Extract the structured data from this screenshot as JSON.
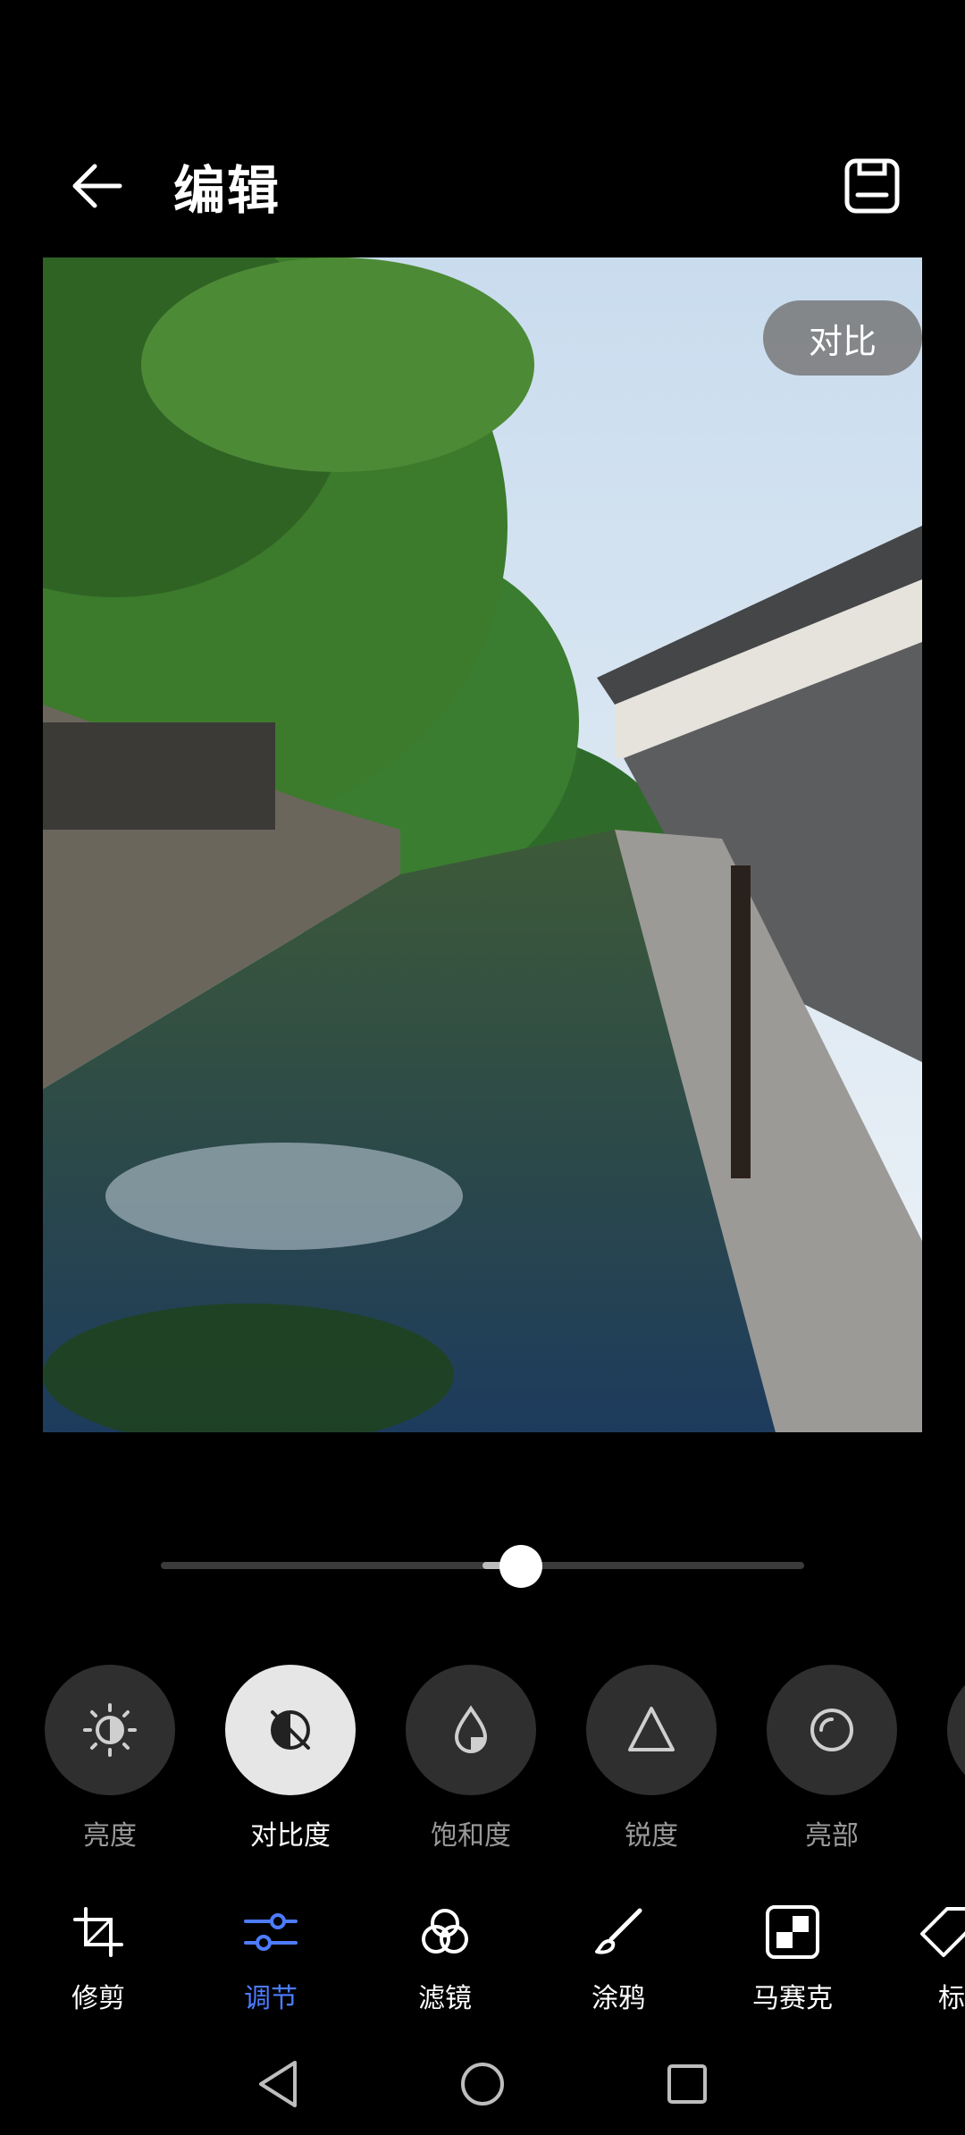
{
  "header": {
    "title": "编辑",
    "back_icon": "arrow-left-icon",
    "save_icon": "save-icon"
  },
  "photo": {
    "tag": "对比",
    "description_icon": "photo-canal-scene"
  },
  "slider": {
    "value_percent": 56
  },
  "adjust_tools": [
    {
      "label": "亮度",
      "icon": "brightness-icon",
      "active": false
    },
    {
      "label": "对比度",
      "icon": "contrast-icon",
      "active": true
    },
    {
      "label": "饱和度",
      "icon": "saturation-icon",
      "active": false
    },
    {
      "label": "锐度",
      "icon": "sharpness-icon",
      "active": false
    },
    {
      "label": "亮部",
      "icon": "highlights-icon",
      "active": false
    }
  ],
  "tabs": [
    {
      "label": "修剪",
      "icon": "crop-icon",
      "active": false
    },
    {
      "label": "调节",
      "icon": "adjust-icon",
      "active": true
    },
    {
      "label": "滤镜",
      "icon": "filter-icon",
      "active": false
    },
    {
      "label": "涂鸦",
      "icon": "brush-icon",
      "active": false
    },
    {
      "label": "马赛克",
      "icon": "mosaic-icon",
      "active": false
    },
    {
      "label": "标",
      "icon": "tag-icon",
      "active": false
    }
  ],
  "colors": {
    "accent": "#4d7cff",
    "background": "#000000"
  }
}
